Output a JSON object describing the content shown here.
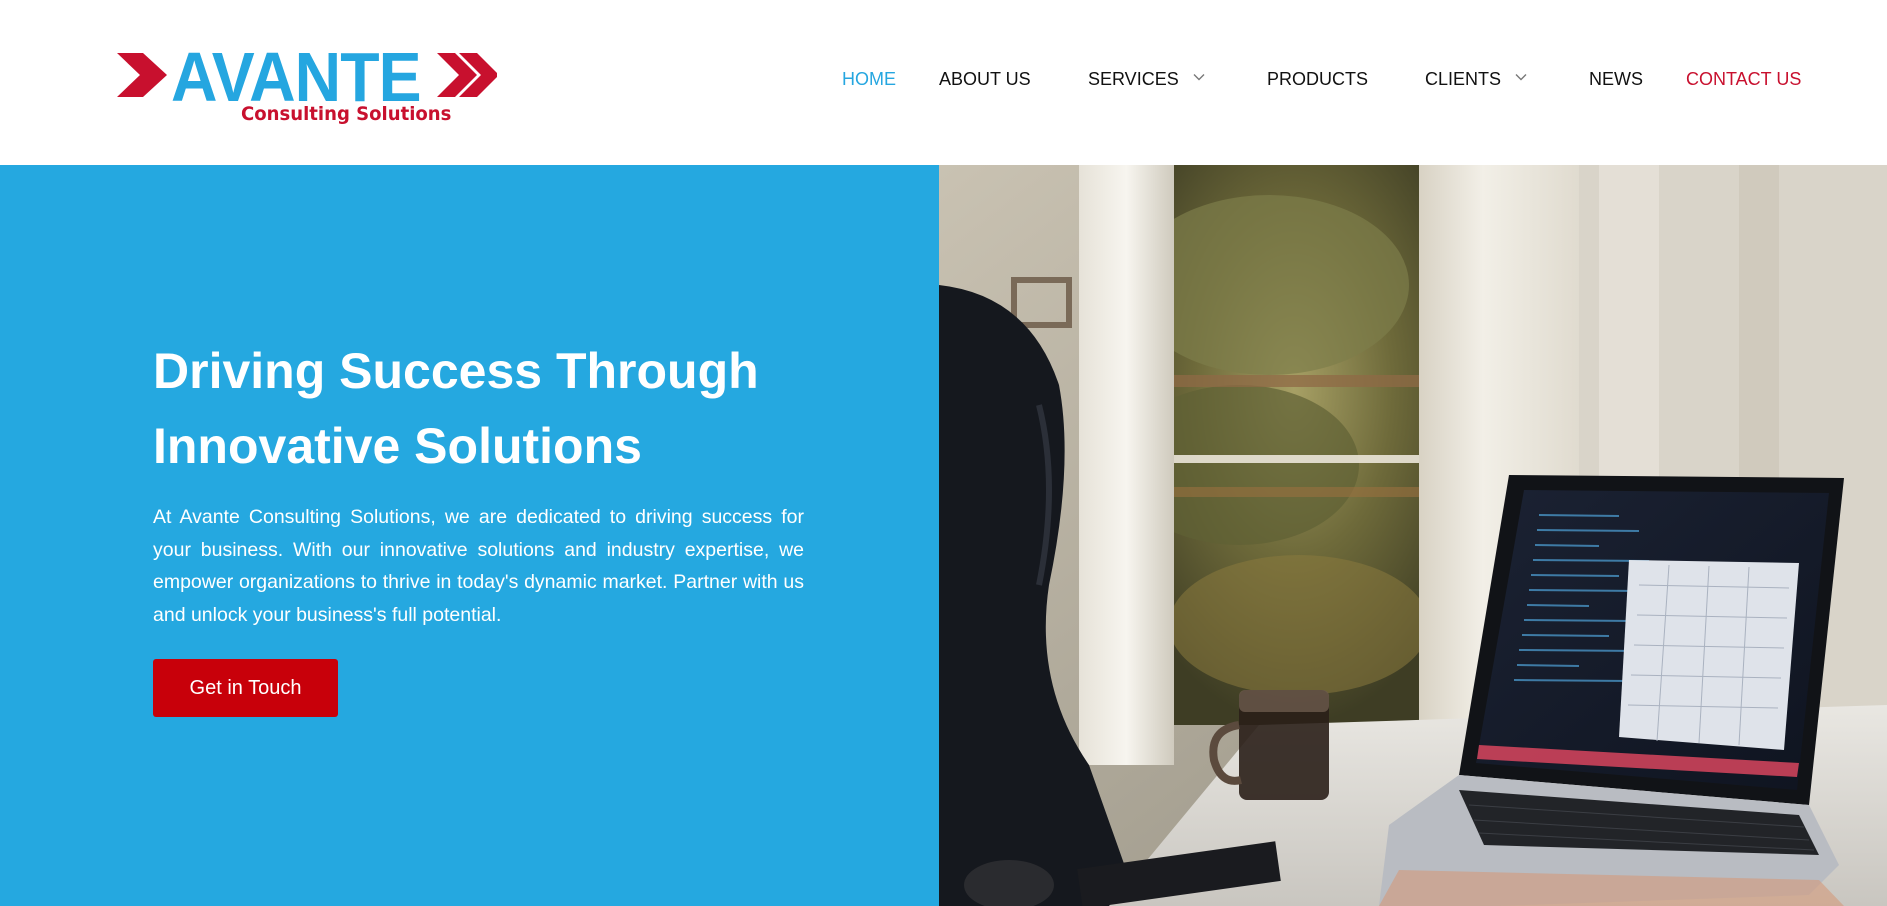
{
  "brand": {
    "name": "AVANTE",
    "tagline": "Consulting Solutions",
    "colors": {
      "primary": "#25a6e0",
      "accent": "#c8102e"
    }
  },
  "nav": {
    "items": [
      {
        "label": "HOME",
        "active": true
      },
      {
        "label": "ABOUT US"
      },
      {
        "label": "SERVICES",
        "has_dropdown": true
      },
      {
        "label": "PRODUCTS"
      },
      {
        "label": "CLIENTS",
        "has_dropdown": true
      },
      {
        "label": "NEWS"
      },
      {
        "label": "CONTACT US",
        "highlight": true
      }
    ],
    "dropdown_icon": "chevron-down-icon"
  },
  "hero": {
    "title_line1": "Driving Success Through",
    "title_line2": "Innovative Solutions",
    "description": "At Avante Consulting Solutions, we are dedicated to driving success for your business. With our innovative solutions and industry expertise, we empower organizations to thrive in today's dynamic market. Partner with us and unlock your business's full potential.",
    "cta_label": "Get in Touch",
    "background_color": "#25a8e0",
    "cta_color": "#c8000a",
    "image": "laptop-on-desk-photo"
  }
}
